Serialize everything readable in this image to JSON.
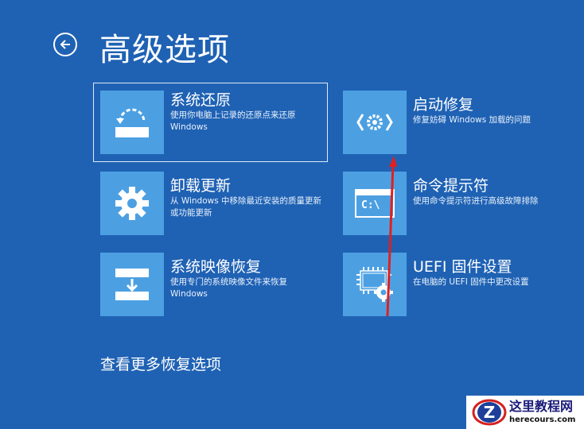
{
  "header": {
    "title": "高级选项"
  },
  "options": [
    {
      "key": "system-restore",
      "title": "系统还原",
      "desc": "使用你电脑上记录的还原点来还原 Windows",
      "icon": "restore-icon"
    },
    {
      "key": "startup-repair",
      "title": "启动修复",
      "desc": "修复妨碍 Windows 加载的问题",
      "icon": "code-gear-icon"
    },
    {
      "key": "uninstall-updates",
      "title": "卸载更新",
      "desc": "从 Windows 中移除最近安装的质量更新或功能更新",
      "icon": "gear-icon"
    },
    {
      "key": "command-prompt",
      "title": "命令提示符",
      "desc": "使用命令提示符进行高级故障排除",
      "icon": "command-prompt-icon",
      "icon_text": "C:\\"
    },
    {
      "key": "system-image-recovery",
      "title": "系统映像恢复",
      "desc": "使用专门的系统映像文件来恢复 Windows",
      "icon": "image-recovery-icon"
    },
    {
      "key": "uefi-firmware-settings",
      "title": "UEFI 固件设置",
      "desc": "在电脑的 UEFI 固件中更改设置",
      "icon": "chip-gear-icon"
    }
  ],
  "more_options": "查看更多恢复选项",
  "watermark": {
    "name": "这里教程网",
    "url": "herecours.com"
  },
  "colors": {
    "background": "#1f62b4",
    "tile": "#4ca0e2",
    "annotation_arrow": "#e02020"
  }
}
